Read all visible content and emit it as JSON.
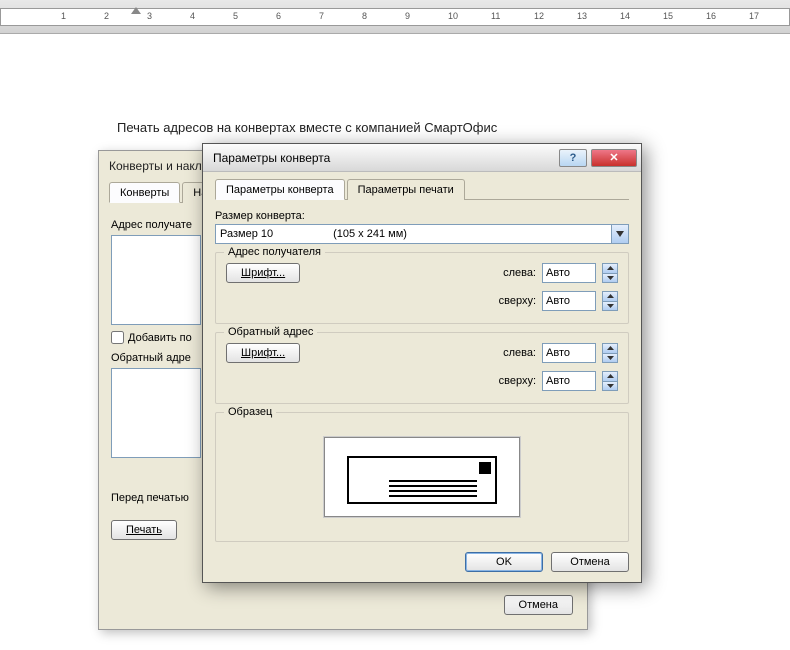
{
  "doc_heading": "Печать адресов на конвертах вместе с компанией СмартОфис",
  "bg_dialog": {
    "title": "Конверты и накле",
    "tabs": [
      "Конверты",
      "На"
    ],
    "recipient_label": "Адрес получате",
    "add_post_checkbox": "Добавить по",
    "return_label": "Обратный адре",
    "before_print": "Перед печатью",
    "print_btn": "Печать",
    "cancel_btn": "Отмена"
  },
  "fg_dialog": {
    "title": "Параметры конверта",
    "tabs": [
      "Параметры конверта",
      "Параметры печати"
    ],
    "size_label": "Размер конверта:",
    "size_value": "Размер 10",
    "size_dim": "(105 x 241 мм)",
    "recipient_group": "Адрес получателя",
    "return_group": "Обратный адрес",
    "font_btn": "Шрифт...",
    "left_label": "слева:",
    "top_label": "сверху:",
    "auto_value": "Авто",
    "preview_label": "Образец",
    "ok_btn": "OK",
    "cancel_btn": "Отмена"
  },
  "ruler_ticks": [
    1,
    2,
    3,
    4,
    5,
    6,
    7,
    8,
    9,
    10,
    11,
    12,
    13,
    14,
    15,
    16,
    17
  ]
}
